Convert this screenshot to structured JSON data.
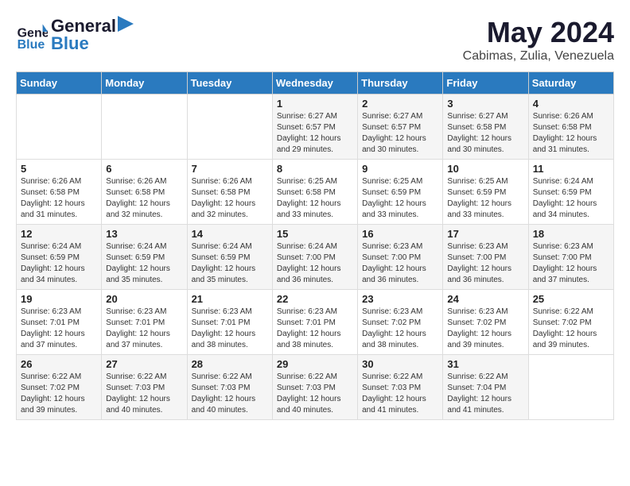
{
  "header": {
    "logo_line1": "General",
    "logo_line2": "Blue",
    "month_year": "May 2024",
    "location": "Cabimas, Zulia, Venezuela"
  },
  "days_of_week": [
    "Sunday",
    "Monday",
    "Tuesday",
    "Wednesday",
    "Thursday",
    "Friday",
    "Saturday"
  ],
  "weeks": [
    [
      {
        "day": "",
        "content": ""
      },
      {
        "day": "",
        "content": ""
      },
      {
        "day": "",
        "content": ""
      },
      {
        "day": "1",
        "content": "Sunrise: 6:27 AM\nSunset: 6:57 PM\nDaylight: 12 hours\nand 29 minutes."
      },
      {
        "day": "2",
        "content": "Sunrise: 6:27 AM\nSunset: 6:57 PM\nDaylight: 12 hours\nand 30 minutes."
      },
      {
        "day": "3",
        "content": "Sunrise: 6:27 AM\nSunset: 6:58 PM\nDaylight: 12 hours\nand 30 minutes."
      },
      {
        "day": "4",
        "content": "Sunrise: 6:26 AM\nSunset: 6:58 PM\nDaylight: 12 hours\nand 31 minutes."
      }
    ],
    [
      {
        "day": "5",
        "content": "Sunrise: 6:26 AM\nSunset: 6:58 PM\nDaylight: 12 hours\nand 31 minutes."
      },
      {
        "day": "6",
        "content": "Sunrise: 6:26 AM\nSunset: 6:58 PM\nDaylight: 12 hours\nand 32 minutes."
      },
      {
        "day": "7",
        "content": "Sunrise: 6:26 AM\nSunset: 6:58 PM\nDaylight: 12 hours\nand 32 minutes."
      },
      {
        "day": "8",
        "content": "Sunrise: 6:25 AM\nSunset: 6:58 PM\nDaylight: 12 hours\nand 33 minutes."
      },
      {
        "day": "9",
        "content": "Sunrise: 6:25 AM\nSunset: 6:59 PM\nDaylight: 12 hours\nand 33 minutes."
      },
      {
        "day": "10",
        "content": "Sunrise: 6:25 AM\nSunset: 6:59 PM\nDaylight: 12 hours\nand 33 minutes."
      },
      {
        "day": "11",
        "content": "Sunrise: 6:24 AM\nSunset: 6:59 PM\nDaylight: 12 hours\nand 34 minutes."
      }
    ],
    [
      {
        "day": "12",
        "content": "Sunrise: 6:24 AM\nSunset: 6:59 PM\nDaylight: 12 hours\nand 34 minutes."
      },
      {
        "day": "13",
        "content": "Sunrise: 6:24 AM\nSunset: 6:59 PM\nDaylight: 12 hours\nand 35 minutes."
      },
      {
        "day": "14",
        "content": "Sunrise: 6:24 AM\nSunset: 6:59 PM\nDaylight: 12 hours\nand 35 minutes."
      },
      {
        "day": "15",
        "content": "Sunrise: 6:24 AM\nSunset: 7:00 PM\nDaylight: 12 hours\nand 36 minutes."
      },
      {
        "day": "16",
        "content": "Sunrise: 6:23 AM\nSunset: 7:00 PM\nDaylight: 12 hours\nand 36 minutes."
      },
      {
        "day": "17",
        "content": "Sunrise: 6:23 AM\nSunset: 7:00 PM\nDaylight: 12 hours\nand 36 minutes."
      },
      {
        "day": "18",
        "content": "Sunrise: 6:23 AM\nSunset: 7:00 PM\nDaylight: 12 hours\nand 37 minutes."
      }
    ],
    [
      {
        "day": "19",
        "content": "Sunrise: 6:23 AM\nSunset: 7:01 PM\nDaylight: 12 hours\nand 37 minutes."
      },
      {
        "day": "20",
        "content": "Sunrise: 6:23 AM\nSunset: 7:01 PM\nDaylight: 12 hours\nand 37 minutes."
      },
      {
        "day": "21",
        "content": "Sunrise: 6:23 AM\nSunset: 7:01 PM\nDaylight: 12 hours\nand 38 minutes."
      },
      {
        "day": "22",
        "content": "Sunrise: 6:23 AM\nSunset: 7:01 PM\nDaylight: 12 hours\nand 38 minutes."
      },
      {
        "day": "23",
        "content": "Sunrise: 6:23 AM\nSunset: 7:02 PM\nDaylight: 12 hours\nand 38 minutes."
      },
      {
        "day": "24",
        "content": "Sunrise: 6:23 AM\nSunset: 7:02 PM\nDaylight: 12 hours\nand 39 minutes."
      },
      {
        "day": "25",
        "content": "Sunrise: 6:22 AM\nSunset: 7:02 PM\nDaylight: 12 hours\nand 39 minutes."
      }
    ],
    [
      {
        "day": "26",
        "content": "Sunrise: 6:22 AM\nSunset: 7:02 PM\nDaylight: 12 hours\nand 39 minutes."
      },
      {
        "day": "27",
        "content": "Sunrise: 6:22 AM\nSunset: 7:03 PM\nDaylight: 12 hours\nand 40 minutes."
      },
      {
        "day": "28",
        "content": "Sunrise: 6:22 AM\nSunset: 7:03 PM\nDaylight: 12 hours\nand 40 minutes."
      },
      {
        "day": "29",
        "content": "Sunrise: 6:22 AM\nSunset: 7:03 PM\nDaylight: 12 hours\nand 40 minutes."
      },
      {
        "day": "30",
        "content": "Sunrise: 6:22 AM\nSunset: 7:03 PM\nDaylight: 12 hours\nand 41 minutes."
      },
      {
        "day": "31",
        "content": "Sunrise: 6:22 AM\nSunset: 7:04 PM\nDaylight: 12 hours\nand 41 minutes."
      },
      {
        "day": "",
        "content": ""
      }
    ]
  ]
}
